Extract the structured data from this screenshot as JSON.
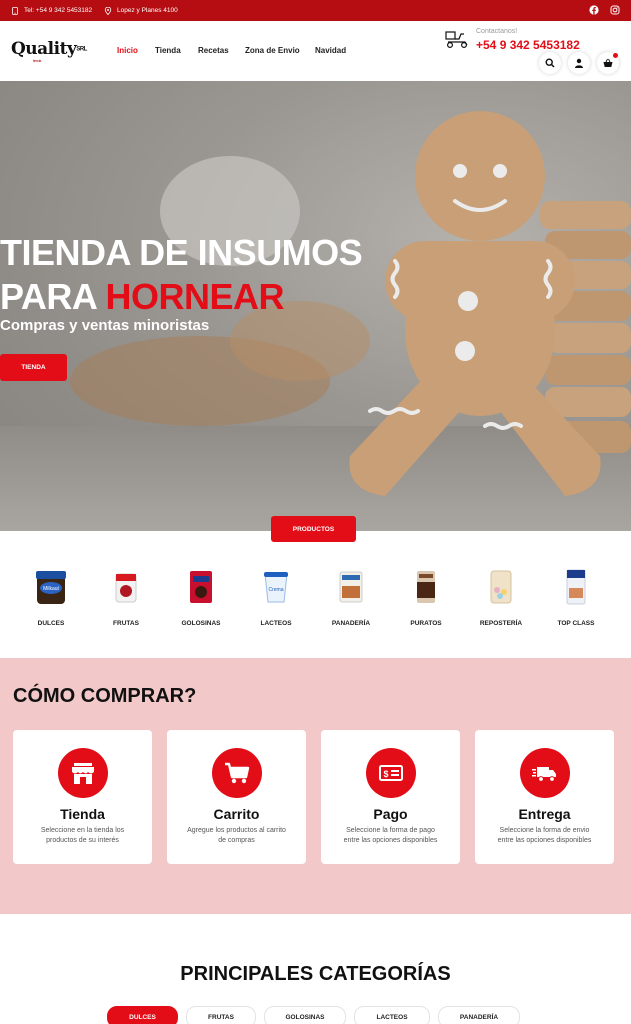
{
  "topbar": {
    "phone": "Tel: +54 9 342 5453182",
    "address": "Lopez y Planes 4100",
    "social": [
      "facebook-icon",
      "instagram-icon"
    ]
  },
  "header": {
    "logo": "Quality",
    "logo_suffix": "SRL",
    "logo_tag": "tienda",
    "nav": [
      "Inicio",
      "Tienda",
      "Recetas",
      "Zona de Envio",
      "Navidad"
    ],
    "active_nav": "Inicio",
    "contact_label": "Contactanos!",
    "contact_phone": "+54 9 342 5453182"
  },
  "hero": {
    "title_line1": "TIENDA DE INSUMOS",
    "title_line2_white": "PARA ",
    "title_line2_red": "HORNEAR",
    "subtitle": "Compras y ventas minoristas",
    "button": "TIENDA"
  },
  "products": {
    "button": "PRODUCTOS",
    "items": [
      {
        "label": "DULCES"
      },
      {
        "label": "FRUTAS"
      },
      {
        "label": "GOLOSINAS"
      },
      {
        "label": "LACTEOS"
      },
      {
        "label": "PANADERÍA"
      },
      {
        "label": "PURATOS"
      },
      {
        "label": "REPOSTERÍA"
      },
      {
        "label": "TOP CLASS"
      }
    ]
  },
  "how_to_buy": {
    "title": "CÓMO COMPRAR?",
    "cards": [
      {
        "icon": "store-icon",
        "title": "Tienda",
        "desc": "Seleccione en la tienda los productos de su interés"
      },
      {
        "icon": "cart-icon",
        "title": "Carrito",
        "desc": "Agregue los productos al carrito de compras"
      },
      {
        "icon": "payment-icon",
        "title": "Pago",
        "desc": "Seleccione la forma de pago entre las opciones disponibles"
      },
      {
        "icon": "delivery-truck-icon",
        "title": "Entrega",
        "desc": "Seleccione la forma de envio entre las opciones disponibles"
      }
    ]
  },
  "categories": {
    "title": "PRINCIPALES CATEGORÍAS",
    "tabs": [
      "DULCES",
      "FRUTAS",
      "GOLOSINAS",
      "LACTEOS",
      "PANADERÍA"
    ],
    "active": "DULCES"
  },
  "colors": {
    "brand_red": "#e20d17",
    "topbar_red": "#b50d12",
    "section_pink": "#f3c8c9"
  }
}
